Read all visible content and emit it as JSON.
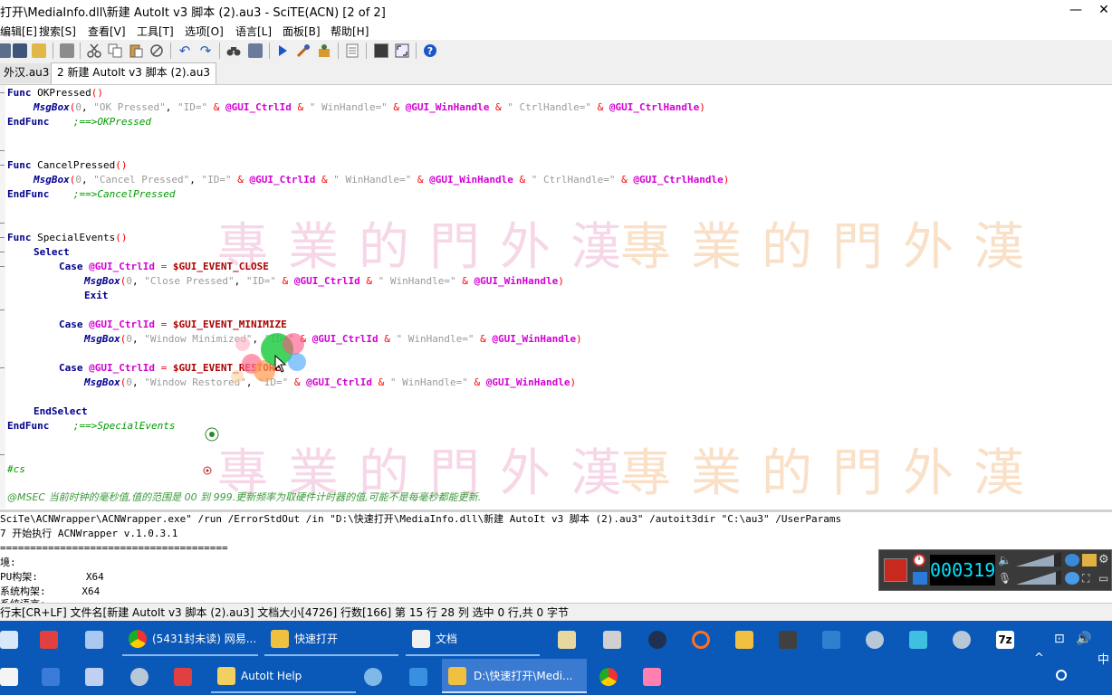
{
  "window": {
    "title": "打开\\MediaInfo.dll\\新建 AutoIt v3 脚本 (2).au3 - SciTE(ACN) [2 of 2]",
    "minimize": "—",
    "close": "✕"
  },
  "menu": {
    "items": [
      "编辑[E]",
      "搜索[S]",
      "查看[V]",
      "工具[T]",
      "选项[O]",
      "语言[L]",
      "面板[B]",
      "帮助[H]"
    ]
  },
  "toolbar": {
    "icons": [
      "new-file-icon",
      "open-folder-icon",
      "save-icon",
      "print-icon",
      "cut-icon",
      "copy-icon",
      "paste-icon",
      "delete-icon",
      "undo-icon",
      "redo-icon",
      "find-icon",
      "replace-icon",
      "run-icon",
      "compile-icon",
      "build-icon",
      "properties-icon",
      "fullscreen-icon",
      "split-icon",
      "help-icon"
    ]
  },
  "tabs": [
    {
      "label": "外汉.au3",
      "active": false
    },
    {
      "label": "2 新建 AutoIt v3 脚本 (2).au3",
      "active": true
    }
  ],
  "code": {
    "l01_kw": "Func",
    "l01_name": " OKPressed",
    "l01_paren": "()",
    "l02_fn": "MsgBox",
    "l02_a": "(",
    "l02_n": "0",
    "l02_b": ", ",
    "l02_s1": "\"OK Pressed\"",
    "l02_c": ", ",
    "l02_s2": "\"ID=\"",
    "l02_o1": " & ",
    "l02_m1": "@GUI_CtrlId",
    "l02_o2": " & ",
    "l02_s3": "\" WinHandle=\"",
    "l02_o3": " & ",
    "l02_m2": "@GUI_WinHandle",
    "l02_o4": " & ",
    "l02_s4": "\" CtrlHandle=\"",
    "l02_o5": " & ",
    "l02_m3": "@GUI_CtrlHandle",
    "l02_e": ")",
    "l03_kw": "EndFunc",
    "l03_cm": ";==>OKPressed",
    "l05_kw": "Func",
    "l05_name": " CancelPressed",
    "l05_paren": "()",
    "l06_fn": "MsgBox",
    "l06_a": "(",
    "l06_n": "0",
    "l06_b": ", ",
    "l06_s1": "\"Cancel Pressed\"",
    "l06_c": ", ",
    "l06_s2": "\"ID=\"",
    "l06_o1": " & ",
    "l06_m1": "@GUI_CtrlId",
    "l06_o2": " & ",
    "l06_s3": "\" WinHandle=\"",
    "l06_o3": " & ",
    "l06_m2": "@GUI_WinHandle",
    "l06_o4": " & ",
    "l06_s4": "\" CtrlHandle=\"",
    "l06_o5": " & ",
    "l06_m3": "@GUI_CtrlHandle",
    "l06_e": ")",
    "l07_kw": "EndFunc",
    "l07_cm": ";==>CancelPressed",
    "l09_kw": "Func",
    "l09_name": " SpecialEvents",
    "l09_paren": "()",
    "l10_kw": "Select",
    "l11_kw": "Case",
    "l11_m": "@GUI_CtrlId",
    "l11_o": " = ",
    "l11_v": "$GUI_EVENT_CLOSE",
    "l12_fn": "MsgBox",
    "l12_a": "(",
    "l12_n": "0",
    "l12_b": ", ",
    "l12_s1": "\"Close Pressed\"",
    "l12_c": ", ",
    "l12_s2": "\"ID=\"",
    "l12_o1": " & ",
    "l12_m1": "@GUI_CtrlId",
    "l12_o2": " & ",
    "l12_s3": "\" WinHandle=\"",
    "l12_o3": " & ",
    "l12_m2": "@GUI_WinHandle",
    "l12_e": ")",
    "l13_kw": "Exit",
    "l15_kw": "Case",
    "l15_m": "@GUI_CtrlId",
    "l15_o": " = ",
    "l15_v": "$GUI_EVENT_MINIMIZE",
    "l16_fn": "MsgBox",
    "l16_a": "(",
    "l16_n": "0",
    "l16_b": ", ",
    "l16_s1": "\"Window Minimized\"",
    "l16_c": ", ",
    "l16_s2": "\"ID=\"",
    "l16_o1": " & ",
    "l16_m1": "@GUI_CtrlId",
    "l16_o2": " & ",
    "l16_s3": "\" WinHandle=\"",
    "l16_o3": " & ",
    "l16_m2": "@GUI_WinHandle",
    "l16_e": ")",
    "l18_kw": "Case",
    "l18_m": "@GUI_CtrlId",
    "l18_o": " = ",
    "l18_v": "$GUI_EVENT_RESTORE",
    "l19_fn": "MsgBox",
    "l19_a": "(",
    "l19_n": "0",
    "l19_b": ", ",
    "l19_s1": "\"Window Restored\"",
    "l19_c": ", ",
    "l19_s2": "\"ID=\"",
    "l19_o1": " & ",
    "l19_m1": "@GUI_CtrlId",
    "l19_o2": " & ",
    "l19_s3": "\" WinHandle=\"",
    "l19_o3": " & ",
    "l19_m2": "@GUI_WinHandle",
    "l19_e": ")",
    "l21_kw": "EndSelect",
    "l22_kw": "EndFunc",
    "l22_cm": ";==>SpecialEvents",
    "l24_cm": "#cs",
    "l26_cm": "@MSEC 当前时钟的毫秒值,值的范围是 00 到 999.更新频率为取硬件计时器的值,可能不是每毫秒都能更新."
  },
  "watermark": {
    "text": "專業的門外漢",
    "color_pink": "#f0a0c8",
    "color_orange": "#f8c090"
  },
  "output": {
    "lines": [
      "SciTe\\ACNWrapper\\ACNWrapper.exe\" /run /ErrorStdOut /in \"D:\\快速打开\\MediaInfo.dll\\新建 AutoIt v3 脚本 (2).au3\" /autoit3dir \"C:\\au3\" /UserParams",
      "7 开始执行 ACNWrapper v.1.0.3.1",
      "======================================",
      "境:",
      "PU构架:        X64",
      "系统构架:      X64",
      "系统语言:"
    ]
  },
  "status": {
    "text": "行末[CR+LF] 文件名[新建 AutoIt v3 脚本 (2).au3] 文档大小[4726] 行数[166] 第 15 行 28 列 选中 0 行,共 0 字节"
  },
  "recorder": {
    "time": "000319"
  },
  "taskbar": {
    "row1": [
      {
        "label": "(5431封未读) 网易...",
        "icon": "chrome-icon"
      },
      {
        "label": "快速打开",
        "icon": "folder-icon"
      },
      {
        "label": "文档",
        "icon": "document-icon"
      }
    ],
    "row2": [
      {
        "label": "AutoIt Help",
        "icon": "autoit-help-icon"
      },
      {
        "label": "D:\\快速打开\\Medi...",
        "icon": "folder-icon"
      }
    ],
    "lang": "中",
    "sevenzip": "7z"
  }
}
